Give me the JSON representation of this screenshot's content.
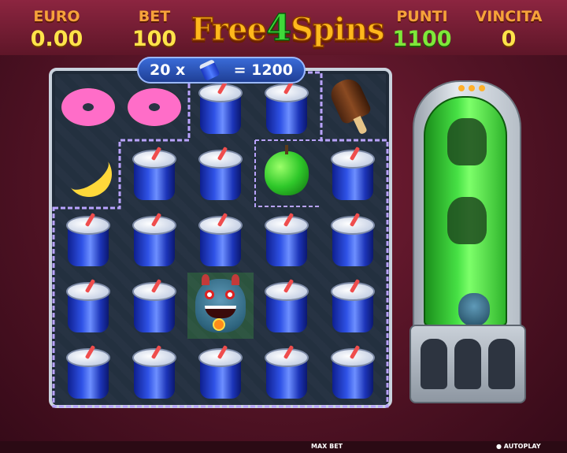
{
  "hud": {
    "euro_label": "EURO",
    "euro_value": "0.00",
    "bet_label": "BET",
    "bet_value": "100",
    "punti_label": "PUNTI",
    "punti_value": "1100",
    "vincita_label": "VINCITA",
    "vincita_value": "0"
  },
  "logo": {
    "part1": "Free",
    "part2": "4",
    "part3": "Spins"
  },
  "multiplier": {
    "count": "20 x",
    "symbol_icon": "soda-can-icon",
    "total": "= 1200"
  },
  "reel": {
    "rows": [
      [
        "donut",
        "donut",
        "can",
        "can",
        "icecream"
      ],
      [
        "banana",
        "can",
        "can",
        "apple",
        "can"
      ],
      [
        "can",
        "can",
        "can",
        "can",
        "can"
      ],
      [
        "can",
        "can",
        "monster",
        "can",
        "can"
      ],
      [
        "can",
        "can",
        "can",
        "can",
        "can"
      ]
    ]
  },
  "footer": {
    "max_bet_label": "MAX BET",
    "autoplay_label": "AUTOPLAY"
  },
  "colors": {
    "lightning": "#b9a3ff",
    "accent_gold": "#ffe34a",
    "accent_green": "#7fe83a"
  }
}
